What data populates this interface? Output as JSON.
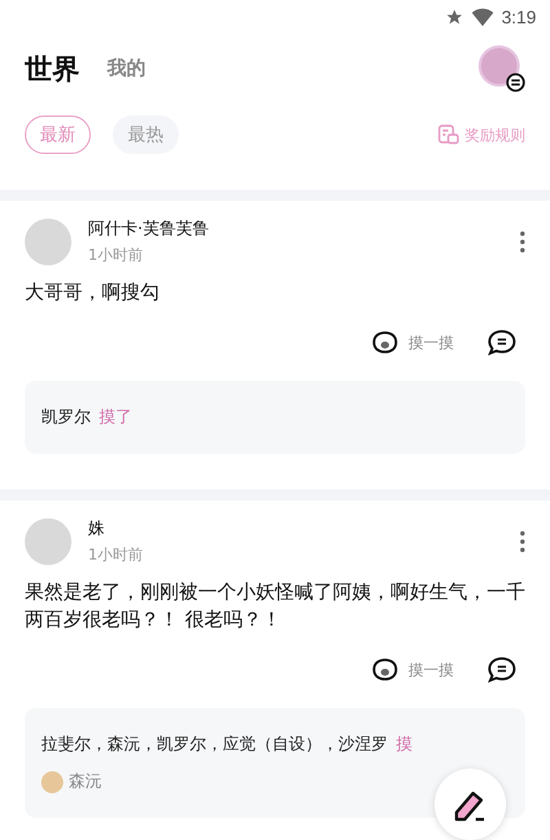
{
  "status_bar": {
    "time": "3:19"
  },
  "header": {
    "tabs": [
      {
        "label": "世界",
        "selected": true
      },
      {
        "label": "我的",
        "selected": false
      }
    ]
  },
  "filters": [
    {
      "label": "最新",
      "selected": true
    },
    {
      "label": "最热",
      "selected": false
    }
  ],
  "rewards_link": "奖励规则",
  "posts": [
    {
      "author": "阿什卡·芙鲁芙鲁",
      "time": "1小时前",
      "text": "大哥哥，啊搜勾",
      "pat_label": "摸一摸",
      "pats": {
        "names": "凯罗尔",
        "action": "摸了"
      }
    },
    {
      "author": "姝",
      "time": "1小时前",
      "text": "果然是老了，刚刚被一个小妖怪喊了阿姨，啊好生气，一千两百岁很老吗？！ 很老吗？！",
      "pat_label": "摸一摸",
      "pats": {
        "names": "拉斐尔，森沅，凯罗尔，应觉（自设），沙涅罗",
        "action": "摸"
      },
      "comment_author": "森沅"
    }
  ]
}
